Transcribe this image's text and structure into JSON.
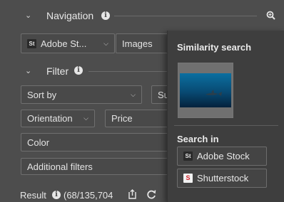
{
  "navigation": {
    "title": "Navigation",
    "source_label": "Adobe St...",
    "type_label": "Images"
  },
  "filter": {
    "title": "Filter",
    "sort_by": "Sort by",
    "sort_partial": "Su",
    "orientation": "Orientation",
    "price": "Price",
    "color": "Color",
    "additional_filters": "Additional filters"
  },
  "result": {
    "label": "Result",
    "count": "(68/135,704"
  },
  "popup": {
    "similarity_title": "Similarity search",
    "search_in_title": "Search in",
    "sources": [
      {
        "label": "Adobe Stock",
        "icon": "adobe-stock-icon"
      },
      {
        "label": "Shutterstock",
        "icon": "shutterstock-icon"
      }
    ]
  },
  "icons": {
    "st_glyph": "St",
    "sh_glyph": "S"
  },
  "colors": {
    "panel_bg": "#4d4d4d",
    "popup_bg": "#3e3e3e",
    "thumbnail_water": "#0a4d6e"
  }
}
